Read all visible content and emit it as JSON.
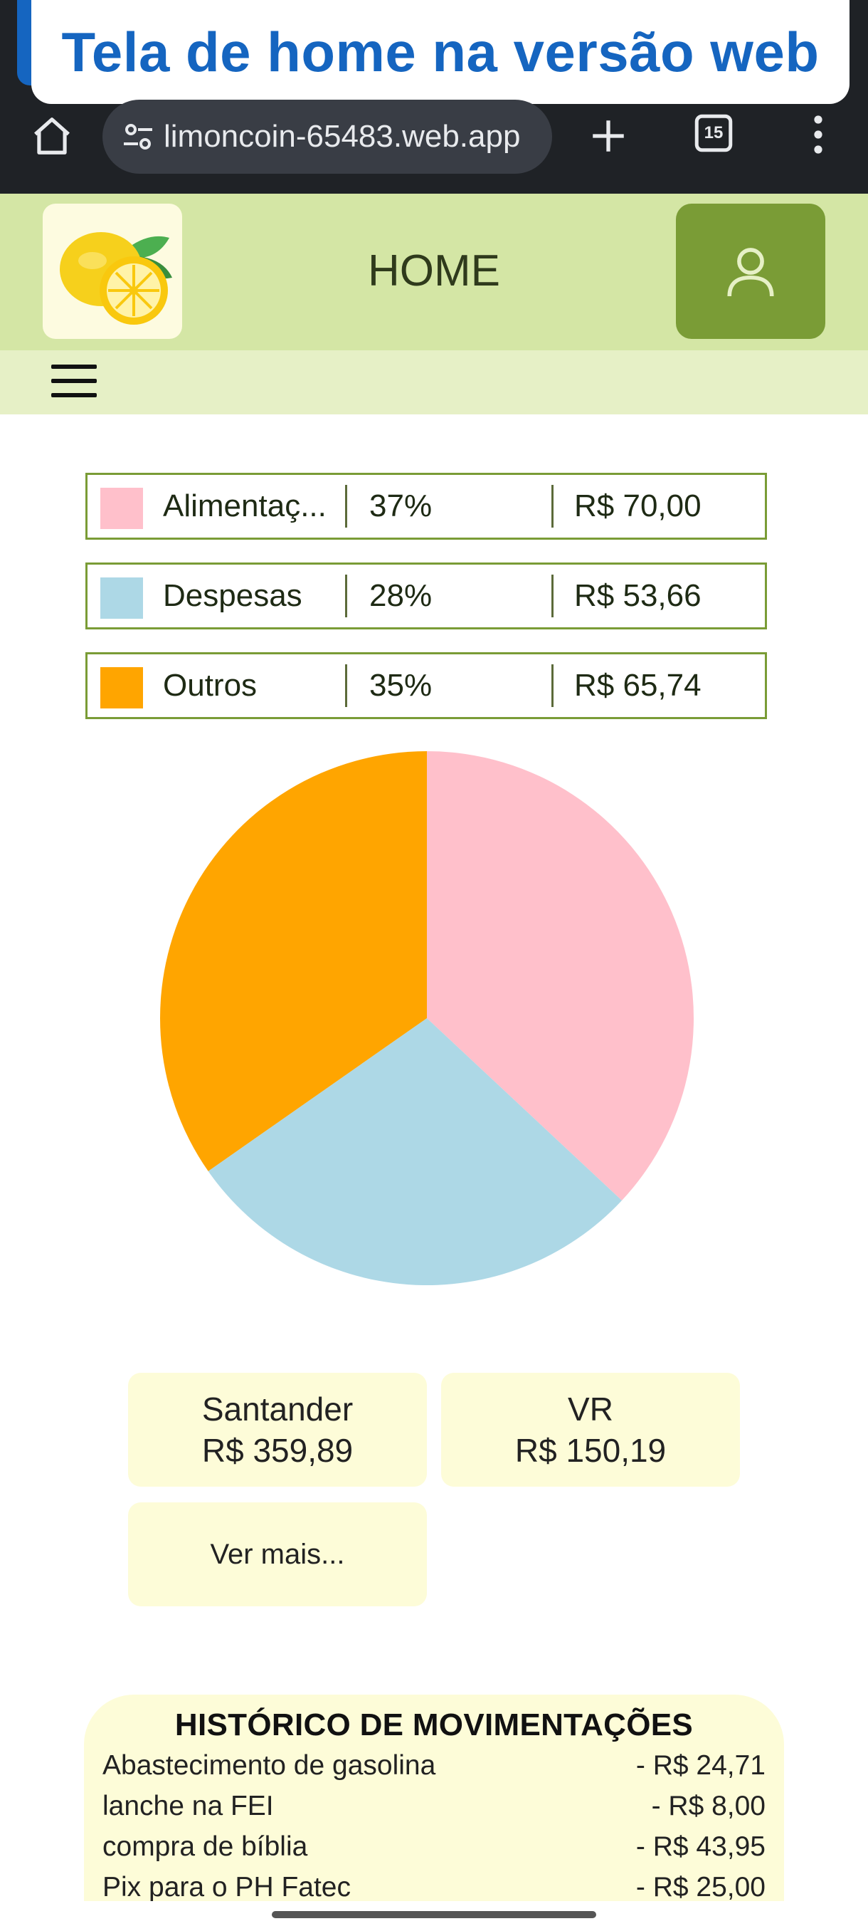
{
  "caption": "Tela de home na versão web",
  "browser": {
    "url": "limoncoin-65483.web.app",
    "tab_count": "15",
    "icons": [
      "home-icon",
      "tune-icon",
      "plus-icon",
      "tabs-icon",
      "more-vert-icon"
    ]
  },
  "header": {
    "title": "HOME",
    "logo_icon": "lemon-logo",
    "profile_icon": "user-icon",
    "menu_icon": "hamburger-icon"
  },
  "legend": [
    {
      "category": "Alimentaç...",
      "percent": "37%",
      "amount": "R$ 70,00",
      "color": "#ffc0cb"
    },
    {
      "category": "Despesas",
      "percent": "28%",
      "amount": "R$ 53,66",
      "color": "#add8e6"
    },
    {
      "category": "Outros",
      "percent": "35%",
      "amount": "R$ 65,74",
      "color": "#ffa500"
    }
  ],
  "chart_data": {
    "type": "pie",
    "categories": [
      "Alimentação",
      "Despesas",
      "Outros"
    ],
    "values": [
      70.0,
      53.66,
      65.74
    ],
    "colors": [
      "#ffc0cb",
      "#add8e6",
      "#ffa500"
    ]
  },
  "accounts": [
    {
      "name": "Santander",
      "balance": "R$ 359,89"
    },
    {
      "name": "VR",
      "balance": "R$ 150,19"
    }
  ],
  "more_label": "Ver mais...",
  "history": {
    "title": "HISTÓRICO DE MOVIMENTAÇÕES",
    "items": [
      {
        "description": "Abastecimento de gasolina",
        "amount": "- R$ 24,71"
      },
      {
        "description": "lanche na FEI",
        "amount": "- R$ 8,00"
      },
      {
        "description": "compra de bíblia",
        "amount": "- R$ 43,95"
      },
      {
        "description": "Pix para o PH Fatec",
        "amount": "- R$ 25,00"
      }
    ]
  },
  "colors": {
    "header_bg": "#d4e6a5",
    "menu_bg": "#e6f0c6",
    "accent_green": "#7a9c36",
    "card_bg": "#fdfcd8",
    "caption_blue": "#1565c0"
  }
}
